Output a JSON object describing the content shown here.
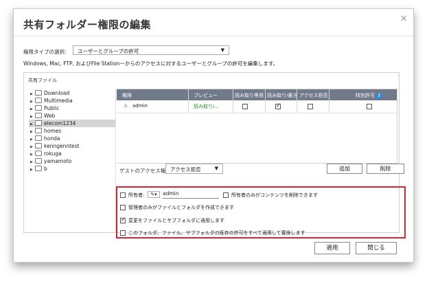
{
  "dialog": {
    "title": "共有フォルダー権限の編集",
    "close_glyph": "×"
  },
  "perm_type": {
    "label": "権限タイプの選択:",
    "value": "ユーザーとグループの許可",
    "arrow": "▼"
  },
  "description": "Windows, Mac, FTP, およびFile Stationーからのアクセスに対するユーザーとグループの許可を編集します。",
  "shared_files": {
    "title": "共有ファイル",
    "folders": [
      {
        "name": "Download",
        "selected": false
      },
      {
        "name": "Multimedia",
        "selected": false
      },
      {
        "name": "Public",
        "selected": false
      },
      {
        "name": "Web",
        "selected": false
      },
      {
        "name": "elecom1234",
        "selected": true
      },
      {
        "name": "homes",
        "selected": false
      },
      {
        "name": "honda",
        "selected": false
      },
      {
        "name": "kenngenntest",
        "selected": false
      },
      {
        "name": "rokuga",
        "selected": false
      },
      {
        "name": "yamamoto",
        "selected": false
      },
      {
        "name": "b",
        "selected": false
      }
    ],
    "tree_glyph": "▶"
  },
  "table": {
    "headers": [
      "権限",
      "プレビュー",
      "読み取り専用",
      "読み取り/書き",
      "アクセス拒否",
      "特別許可"
    ],
    "info_glyph": "i",
    "rows": [
      {
        "user": "admin",
        "preview": "読み取り/...",
        "ro": false,
        "rw": true,
        "deny": false,
        "special": false
      }
    ],
    "user_glyph": "♙"
  },
  "guest": {
    "label": "ゲストのアクセス権:",
    "value": "アクセス拒否",
    "arrow": "▼"
  },
  "buttons": {
    "add": "追加",
    "delete": "削除",
    "apply": "適用",
    "close": "閉じる"
  },
  "options": {
    "owner_label": "所有者:",
    "owner_value": "admin",
    "pencil_glyph": "✎▾",
    "owner_delete_only": "所有者のみがコンテンツを削除できます",
    "admin_create_only": "管理者のみがファイルとフォルダを作成できます",
    "apply_changes": "変更をファイルとサブフォルダに適用します",
    "replace_all": "このフォルダ、ファイル、サブフォルダの既存の許可をすべて適用して置換します",
    "states": {
      "owner": false,
      "owner_delete_only": false,
      "admin_create_only": false,
      "apply_changes": true,
      "replace_all": false
    }
  }
}
